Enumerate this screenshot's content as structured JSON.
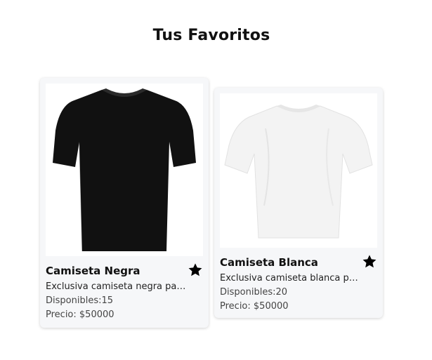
{
  "page": {
    "title": "Tus Favoritos"
  },
  "favorites": [
    {
      "name": "Camiseta Negra",
      "description": "Exclusiva camiseta negra para todos los dias",
      "stock_label": "Disponibles:",
      "stock": "15",
      "price_label": "Precio: ",
      "price": "$50000",
      "shirt_color": "#111111",
      "icon": "star-icon"
    },
    {
      "name": "Camiseta Blanca",
      "description": "Exclusiva camiseta blanca para todos los dias",
      "stock_label": "Disponibles:",
      "stock": "20",
      "price_label": "Precio: ",
      "price": "$50000",
      "shirt_color": "#f2f2f2",
      "icon": "star-icon"
    }
  ]
}
